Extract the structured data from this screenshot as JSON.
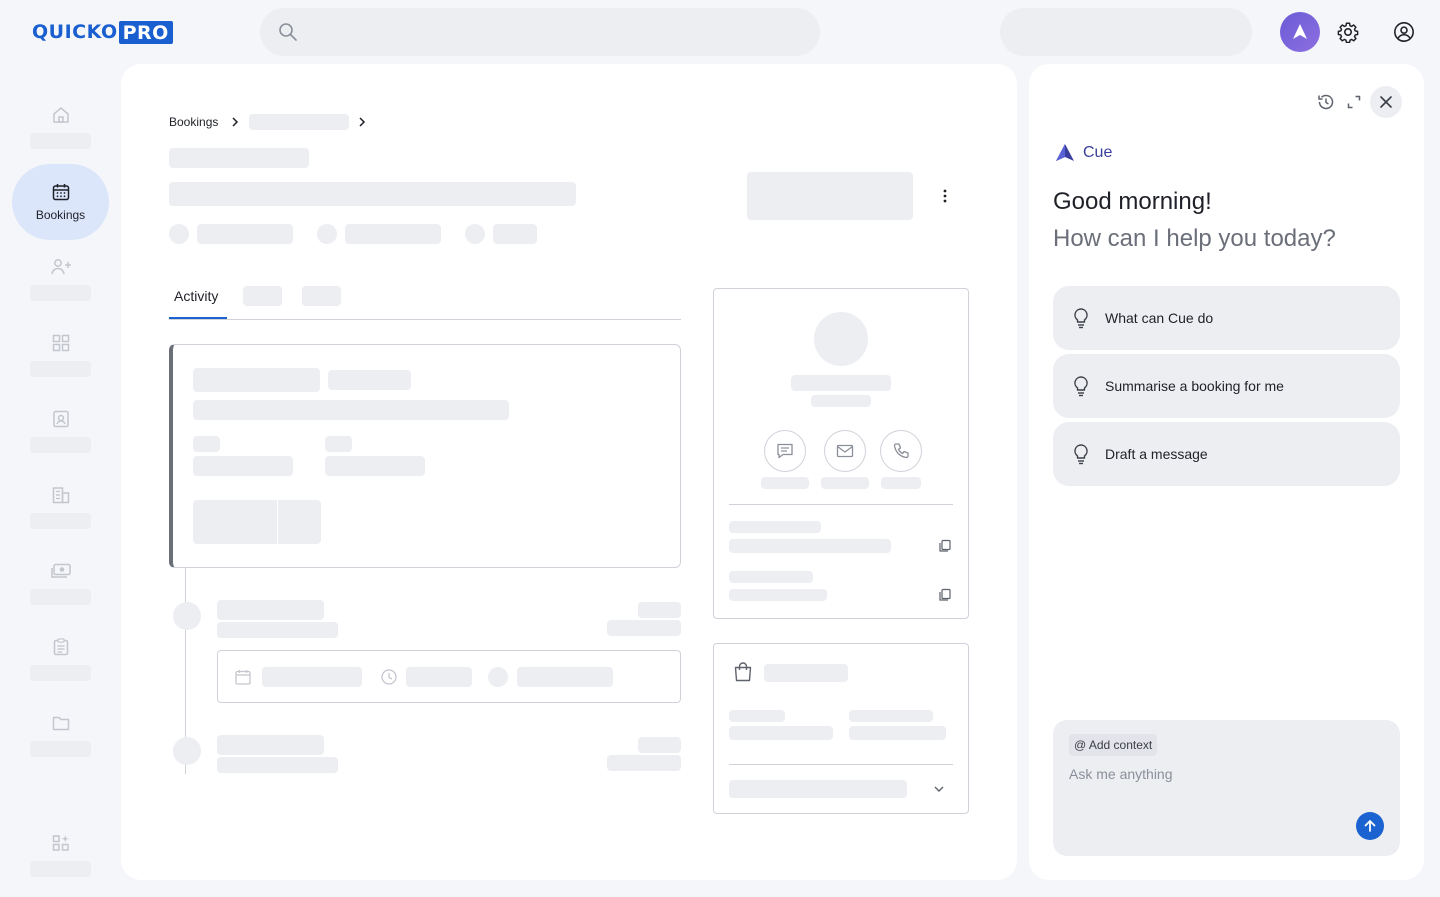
{
  "brand": {
    "logo_left": "QUICKO",
    "logo_right": "PRO"
  },
  "sidebar": {
    "items": [
      {
        "icon": "home-icon",
        "label": ""
      },
      {
        "icon": "calendar-icon",
        "label": "Bookings",
        "active": true
      },
      {
        "icon": "users-add-icon",
        "label": ""
      },
      {
        "icon": "grid-icon",
        "label": ""
      },
      {
        "icon": "contact-card-icon",
        "label": ""
      },
      {
        "icon": "building-icon",
        "label": ""
      },
      {
        "icon": "money-icon",
        "label": ""
      },
      {
        "icon": "clipboard-icon",
        "label": ""
      },
      {
        "icon": "folder-icon",
        "label": ""
      },
      {
        "icon": "apps-sparkle-icon",
        "label": ""
      }
    ]
  },
  "breadcrumb": {
    "root": "Bookings"
  },
  "tabs": {
    "active": "Activity"
  },
  "assistant": {
    "name": "Cue",
    "greeting": "Good morning!",
    "prompt": "How can I help you today?",
    "suggestions": [
      "What can Cue do",
      "Summarise a booking for me",
      "Draft a message"
    ],
    "context_chip": "@ Add context",
    "input_placeholder": "Ask me anything"
  },
  "colors": {
    "accent": "#1a63d1",
    "active_nav": "#dbe6fb",
    "skeleton": "#eceef2"
  }
}
